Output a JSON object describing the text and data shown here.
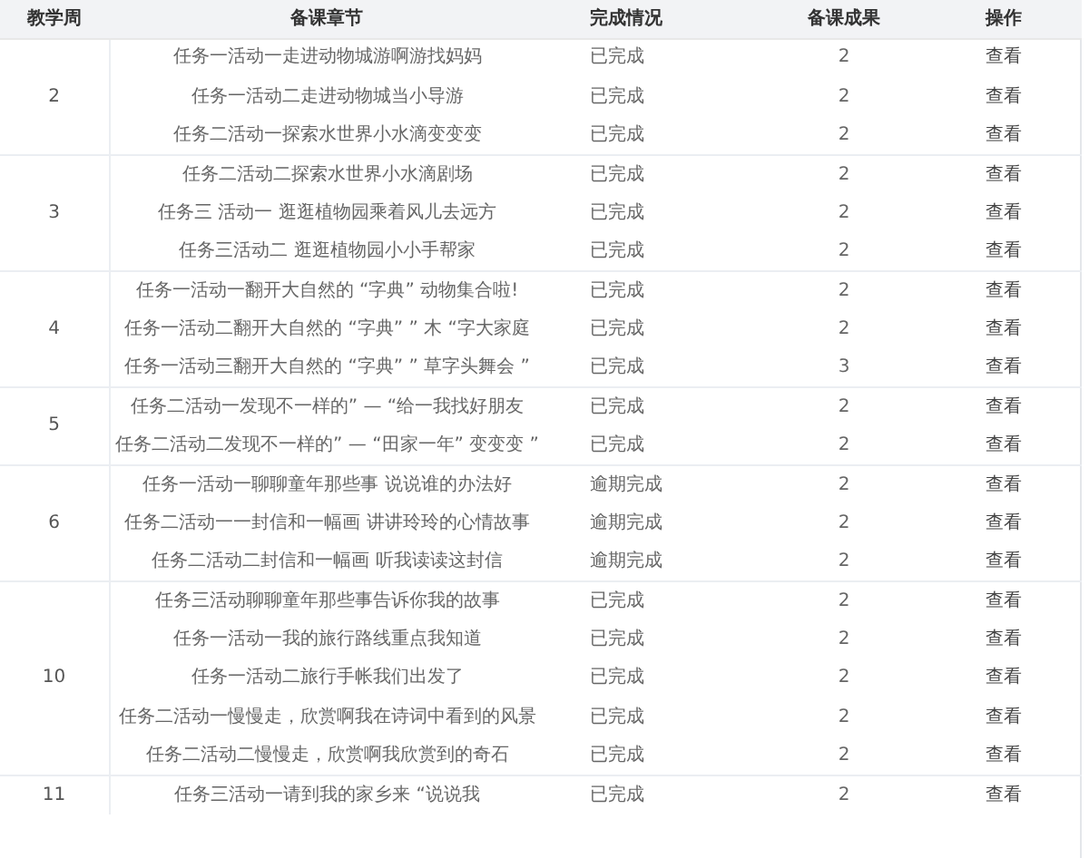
{
  "table": {
    "columns": [
      "教学周",
      "备课章节",
      "完成情况",
      "备课成果",
      "操作"
    ],
    "weeks": [
      {
        "week": "2",
        "lessons": [
          {
            "chapter": "任务一活动一走进动物城游啊游找妈妈",
            "status": "已完成",
            "result": "2",
            "action": "查看"
          },
          {
            "chapter": "任务一活动二走进动物城当小导游",
            "status": "已完成",
            "result": "2",
            "action": "查看"
          },
          {
            "chapter": "任务二活动一探索水世界小水滴变变变",
            "status": "已完成",
            "result": "2",
            "action": "查看"
          }
        ]
      },
      {
        "week": "3",
        "lessons": [
          {
            "chapter": "任务二活动二探索水世界小水滴剧场",
            "status": "已完成",
            "result": "2",
            "action": "查看"
          },
          {
            "chapter": "任务三 活动一 逛逛植物园乘着风儿去远方",
            "status": "已完成",
            "result": "2",
            "action": "查看"
          },
          {
            "chapter": "任务三活动二 逛逛植物园小小手帮家",
            "status": "已完成",
            "result": "2",
            "action": "查看"
          }
        ]
      },
      {
        "week": "4",
        "lessons": [
          {
            "chapter": "任务一活动一翻开大自然的 “字典” 动物集合啦!",
            "status": "已完成",
            "result": "2",
            "action": "查看"
          },
          {
            "chapter": "任务一活动二翻开大自然的 “字典” ” 木 “字大家庭",
            "status": "已完成",
            "result": "2",
            "action": "查看"
          },
          {
            "chapter": "任务一活动三翻开大自然的 “字典” ” 草字头舞会 ”",
            "status": "已完成",
            "result": "3",
            "action": "查看"
          }
        ]
      },
      {
        "week": "5",
        "lessons": [
          {
            "chapter": "任务二活动一发现不一样的” — “给一我找好朋友",
            "status": "已完成",
            "result": "2",
            "action": "查看"
          },
          {
            "chapter": "任务二活动二发现不一样的” — “田家一年” 变变变 ”",
            "status": "已完成",
            "result": "2",
            "action": "查看"
          }
        ]
      },
      {
        "week": "6",
        "lessons": [
          {
            "chapter": "任务一活动一聊聊童年那些事 说说谁的办法好",
            "status": "逾期完成",
            "result": "2",
            "action": "查看"
          },
          {
            "chapter": "任务二活动一一封信和一幅画 讲讲玲玲的心情故事",
            "status": "逾期完成",
            "result": "2",
            "action": "查看"
          },
          {
            "chapter": "任务二活动二封信和一幅画 听我读读这封信",
            "status": "逾期完成",
            "result": "2",
            "action": "查看"
          }
        ]
      },
      {
        "week": "10",
        "lessons": [
          {
            "chapter": "任务三活动聊聊童年那些事告诉你我的故事",
            "status": "已完成",
            "result": "2",
            "action": "查看"
          },
          {
            "chapter": "任务一活动一我的旅行路线重点我知道",
            "status": "已完成",
            "result": "2",
            "action": "查看"
          },
          {
            "chapter": "任务一活动二旅行手帐我们出发了",
            "status": "已完成",
            "result": "2",
            "action": "查看"
          },
          {
            "chapter": "任务二活动一慢慢走，欣赏啊我在诗词中看到的风景",
            "status": "已完成",
            "result": "2",
            "action": "查看"
          },
          {
            "chapter": "任务二活动二慢慢走，欣赏啊我欣赏到的奇石",
            "status": "已完成",
            "result": "2",
            "action": "查看"
          }
        ]
      },
      {
        "week": "11",
        "lessons": [
          {
            "chapter": "任务三活动一请到我的家乡来 “说说我",
            "status": "已完成",
            "result": "2",
            "action": "查看"
          }
        ]
      }
    ]
  }
}
